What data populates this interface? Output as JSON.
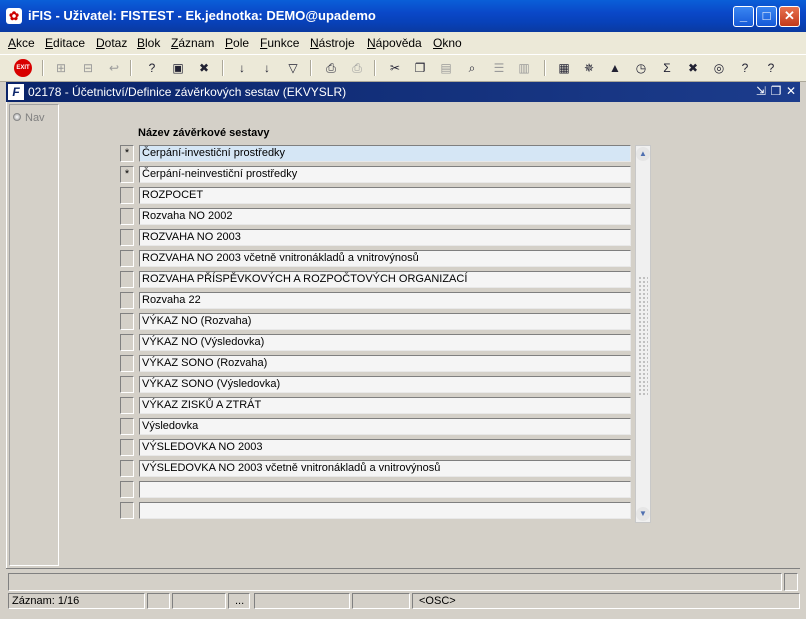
{
  "window": {
    "title": "iFIS - Uživatel: FISTEST - Ek.jednotka: DEMO@upademo",
    "app_icon": "ifis-app-icon",
    "controls": [
      "minimize",
      "maximize",
      "close"
    ]
  },
  "menu": [
    "Akce",
    "Editace",
    "Dotaz",
    "Blok",
    "Záznam",
    "Pole",
    "Funkce",
    "Nástroje",
    "Nápověda",
    "Okno"
  ],
  "toolbar": {
    "exit_label": "EXIT",
    "icons": [
      "exit-icon",
      "insert-record-icon",
      "delete-record-icon",
      "clear-record-icon",
      "enter-query-icon",
      "execute-query-icon",
      "cancel-query-icon",
      "sort-ascending-icon",
      "sort-descending-icon",
      "filter-icon",
      "print-icon",
      "print-preview-icon",
      "cut-icon",
      "copy-icon",
      "paste-icon",
      "find-icon",
      "list-icon",
      "columns-icon",
      "form-icon",
      "settings-icon",
      "up-icon",
      "clock-icon",
      "sum-icon",
      "excel-icon",
      "web-icon",
      "help-query-icon",
      "help-icon"
    ]
  },
  "form": {
    "title": "02178 - Účetnictví/Definice závěrkových sestav (EKVYSLR)",
    "nav_label": "Nav",
    "column_header": "Název závěrkové sestavy",
    "rows": [
      {
        "marker": "*",
        "name": "Čerpání-investiční prostředky"
      },
      {
        "marker": "*",
        "name": "Čerpání-neinvestiční prostředky"
      },
      {
        "marker": "",
        "name": "ROZPOCET"
      },
      {
        "marker": "",
        "name": "Rozvaha NO 2002"
      },
      {
        "marker": "",
        "name": "ROZVAHA NO 2003"
      },
      {
        "marker": "",
        "name": "ROZVAHA NO 2003 včetně vnitronákladů a vnitrovýnosů"
      },
      {
        "marker": "",
        "name": "ROZVAHA PŘÍSPĚVKOVÝCH A ROZPOČTOVÝCH ORGANIZACÍ"
      },
      {
        "marker": "",
        "name": "Rozvaha 22"
      },
      {
        "marker": "",
        "name": "VÝKAZ NO (Rozvaha)"
      },
      {
        "marker": "",
        "name": "VÝKAZ NO (Výsledovka)"
      },
      {
        "marker": "",
        "name": "VÝKAZ SONO (Rozvaha)"
      },
      {
        "marker": "",
        "name": "VÝKAZ SONO (Výsledovka)"
      },
      {
        "marker": "",
        "name": "VÝKAZ ZISKŮ A ZTRÁT"
      },
      {
        "marker": "",
        "name": "Výsledovka"
      },
      {
        "marker": "",
        "name": "VÝSLEDOVKA NO 2003"
      },
      {
        "marker": "",
        "name": "VÝSLEDOVKA NO 2003 včetně vnitronákladů a vnitrovýnosů"
      },
      {
        "marker": "",
        "name": ""
      },
      {
        "marker": "",
        "name": ""
      }
    ],
    "selected_row": 0
  },
  "status": {
    "record": "Záznam: 1/16",
    "field3": "...",
    "mode": "<OSC>"
  }
}
